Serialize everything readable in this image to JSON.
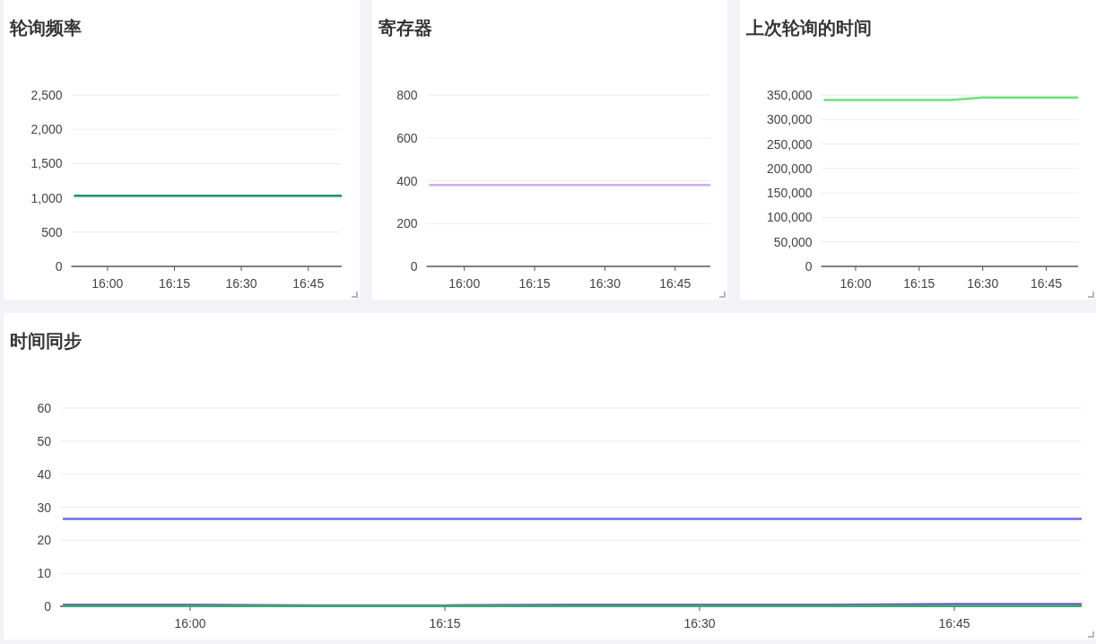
{
  "panels": [
    {
      "title": "轮询频率",
      "chart_data": {
        "type": "line",
        "grid": true,
        "categories": [
          null,
          "16:00",
          null,
          "16:15",
          null,
          "16:30",
          null,
          "16:45",
          null
        ],
        "ylim": [
          0,
          2500
        ],
        "yticks": [
          0,
          500,
          {
            "value": 1000,
            "label": "1,000"
          },
          {
            "value": 1500,
            "label": "1,500"
          },
          {
            "value": 2000,
            "label": "2,000"
          },
          {
            "value": 2500,
            "label": "2,500"
          }
        ],
        "series": [
          {
            "color": "#15936a",
            "values": [
              1030,
              1030,
              1030,
              1030,
              1030,
              1030,
              1030,
              1030,
              1030
            ]
          }
        ]
      }
    },
    {
      "title": "寄存器",
      "chart_data": {
        "type": "line",
        "grid": true,
        "categories": [
          null,
          "16:00",
          null,
          "16:15",
          null,
          "16:30",
          null,
          "16:45",
          null
        ],
        "ylim": [
          0,
          800
        ],
        "yticks": [
          0,
          200,
          400,
          600,
          800
        ],
        "series": [
          {
            "color": "#d3a9f0",
            "values": [
              380,
              380,
              380,
              380,
              380,
              380,
              380,
              380,
              380
            ]
          }
        ]
      }
    },
    {
      "title": "上次轮询的时间",
      "chart_data": {
        "type": "line",
        "grid": true,
        "categories": [
          null,
          "16:00",
          null,
          "16:15",
          null,
          "16:30",
          null,
          "16:45",
          null
        ],
        "ylim": [
          0,
          350000
        ],
        "yticks": [
          0,
          {
            "value": 50000,
            "label": "50,000"
          },
          {
            "value": 100000,
            "label": "100,000"
          },
          {
            "value": 150000,
            "label": "150,000"
          },
          {
            "value": 200000,
            "label": "200,000"
          },
          {
            "value": 250000,
            "label": "250,000"
          },
          {
            "value": 300000,
            "label": "300,000"
          },
          {
            "value": 350000,
            "label": "350,000"
          }
        ],
        "series": [
          {
            "color": "#6fe07a",
            "values": [
              340000,
              340000,
              340000,
              340000,
              340000,
              345000,
              345000,
              345000,
              345000
            ]
          }
        ]
      }
    },
    {
      "title": "时间同步",
      "chart_data": {
        "type": "line",
        "grid": true,
        "categories": [
          null,
          "16:00",
          null,
          "16:15",
          null,
          "16:30",
          null,
          "16:45",
          null
        ],
        "ylim": [
          0,
          60
        ],
        "yticks": [
          0,
          10,
          20,
          30,
          40,
          50,
          60
        ],
        "series": [
          {
            "color": "#6b6bea",
            "values": [
              26.5,
              26.5,
              26.5,
              26.5,
              26.5,
              26.5,
              26.5,
              26.5,
              26.5
            ]
          },
          {
            "color": "#7a4fd6",
            "values": [
              0.5,
              0.5,
              0.3,
              0.3,
              0.5,
              0.5,
              0.5,
              0.7,
              0.7
            ]
          },
          {
            "color": "#2fb36b",
            "values": [
              0.1,
              0.1,
              0.1,
              0.1,
              0.1,
              0.1,
              0.1,
              0.1,
              0.1
            ]
          }
        ]
      }
    }
  ]
}
